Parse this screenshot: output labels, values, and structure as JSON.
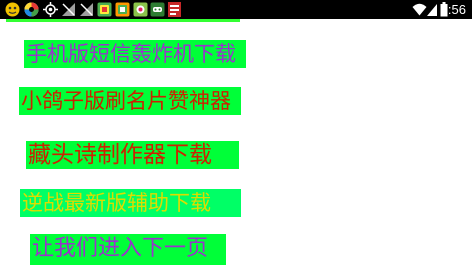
{
  "status_bar": {
    "time": "9:56",
    "icons_left": [
      "android-avatar-icon",
      "palette-icon",
      "gps-icon",
      "no-sim-icon",
      "no-sim-icon",
      "app-icon",
      "app-icon",
      "game-icon",
      "notification-icon"
    ],
    "icons_right": [
      "wifi-icon",
      "signal-icon",
      "battery-icon"
    ]
  },
  "links": [
    {
      "label": "手机版短信轰炸机下载",
      "color": "#9933cc"
    },
    {
      "label": "小鸽子版刷名片赞神器",
      "color": "#cc2200"
    },
    {
      "label": "藏头诗制作器下载",
      "color": "#cc2200"
    },
    {
      "label": "逆战最新版辅助下载",
      "color": "#dddd00"
    },
    {
      "label": "让我们进入下一页",
      "color": "#9933cc"
    }
  ]
}
